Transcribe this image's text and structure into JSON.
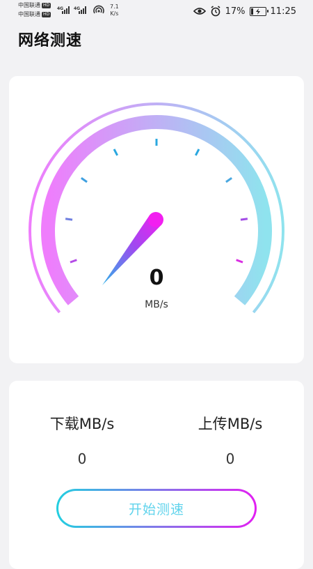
{
  "status_bar": {
    "carrier_1": "中国联通",
    "carrier_2": "中国联通",
    "hd_badge": "HD",
    "network_type": "4G",
    "network_type_2": "4G",
    "net_speed_value": "7.1",
    "net_speed_unit": "K/s",
    "battery_percent": "17%",
    "battery_level": 0.17,
    "time": "11:25"
  },
  "page": {
    "title": "网络测速"
  },
  "gauge": {
    "speed_value": "0",
    "speed_unit": "MB/s",
    "gradient_start": "#ef7dfc",
    "gradient_end": "#8fe3ee"
  },
  "results": {
    "download_label": "下载MB/s",
    "download_value": "0",
    "upload_label": "上传MB/s",
    "upload_value": "0"
  },
  "actions": {
    "start_label": "开始测速",
    "button_gradient_start": "#22cfe0",
    "button_gradient_end": "#e21ff2"
  }
}
